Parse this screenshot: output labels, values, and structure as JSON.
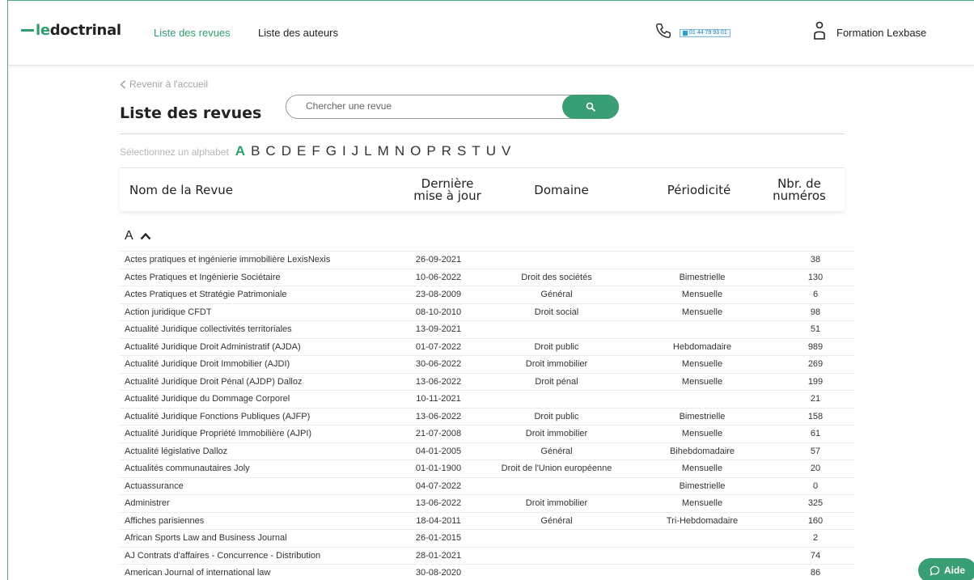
{
  "header": {
    "logo_prefix": "le",
    "logo_suffix": "doctrinal",
    "nav": [
      {
        "label": "Liste des revues",
        "active": true
      },
      {
        "label": "Liste des auteurs",
        "active": false
      }
    ],
    "phone_number": "01 44 79 93 01",
    "user_name": "Formation Lexbase"
  },
  "back_link": "Revenir à l'accueil",
  "page_title": "Liste des revues",
  "search": {
    "placeholder": "Chercher une revue",
    "value": ""
  },
  "alphabet": {
    "label": "Sélectionnez un alphabet",
    "letters": [
      "A",
      "B",
      "C",
      "D",
      "E",
      "F",
      "G",
      "I",
      "J",
      "L",
      "M",
      "N",
      "O",
      "P",
      "R",
      "S",
      "T",
      "U",
      "V"
    ],
    "active": "A"
  },
  "table": {
    "headers": {
      "name": "Nom de la Revue",
      "date_line1": "Dernière",
      "date_line2": "mise à jour",
      "domain": "Domaine",
      "periodicity": "Périodicité",
      "count_line1": "Nbr. de",
      "count_line2": "numéros"
    },
    "section": "A",
    "rows": [
      {
        "name": "Actes pratiques et ingénierie immobilière LexisNexis",
        "date": "26-09-2021",
        "domain": "",
        "periodicity": "",
        "count": "38"
      },
      {
        "name": "Actes Pratiques et Ingénierie Sociétaire",
        "date": "10-06-2022",
        "domain": "Droit des sociétés",
        "periodicity": "Bimestrielle",
        "count": "130"
      },
      {
        "name": "Actes Pratiques et Stratégie Patrimoniale",
        "date": "23-08-2009",
        "domain": "Général",
        "periodicity": "Mensuelle",
        "count": "6"
      },
      {
        "name": "Action juridique CFDT",
        "date": "08-10-2010",
        "domain": "Droit social",
        "periodicity": "Mensuelle",
        "count": "98"
      },
      {
        "name": "Actualité Juridique collectivités territoriales",
        "date": "13-09-2021",
        "domain": "",
        "periodicity": "",
        "count": "51"
      },
      {
        "name": "Actualité Juridique Droit Administratif (AJDA)",
        "date": "01-07-2022",
        "domain": "Droit public",
        "periodicity": "Hebdomadaire",
        "count": "989"
      },
      {
        "name": "Actualité Juridique Droit Immobilier (AJDI)",
        "date": "30-06-2022",
        "domain": "Droit immobilier",
        "periodicity": "Mensuelle",
        "count": "269"
      },
      {
        "name": "Actualité Juridique Droit Pénal (AJDP) Dalloz",
        "date": "13-06-2022",
        "domain": "Droit pénal",
        "periodicity": "Mensuelle",
        "count": "199"
      },
      {
        "name": "Actualité Juridique du Dommage Corporel",
        "date": "10-11-2021",
        "domain": "",
        "periodicity": "",
        "count": "21"
      },
      {
        "name": "Actualité Juridique Fonctions Publiques (AJFP)",
        "date": "13-06-2022",
        "domain": "Droit public",
        "periodicity": "Bimestrielle",
        "count": "158"
      },
      {
        "name": "Actualité Juridique Propriété Immobilière (AJPI)",
        "date": "21-07-2008",
        "domain": "Droit immobilier",
        "periodicity": "Mensuelle",
        "count": "61"
      },
      {
        "name": "Actualité législative Dalloz",
        "date": "04-01-2005",
        "domain": "Général",
        "periodicity": "Bihebdomadaire",
        "count": "57"
      },
      {
        "name": "Actualités communautaires Joly",
        "date": "01-01-1900",
        "domain": "Droit de l'Union européenne",
        "periodicity": "Mensuelle",
        "count": "20"
      },
      {
        "name": "Actuassurance",
        "date": "04-07-2022",
        "domain": "",
        "periodicity": "Bimestrielle",
        "count": "0"
      },
      {
        "name": "Administrer",
        "date": "13-06-2022",
        "domain": "Droit immobilier",
        "periodicity": "Mensuelle",
        "count": "325"
      },
      {
        "name": "Affiches parisiennes",
        "date": "18-04-2011",
        "domain": "Général",
        "periodicity": "Tri-Hebdomadaire",
        "count": "160"
      },
      {
        "name": "African Sports Law and Business Journal",
        "date": "26-01-2015",
        "domain": "",
        "periodicity": "",
        "count": "2"
      },
      {
        "name": "AJ Contrats d'affaires - Concurrence - Distribution",
        "date": "28-01-2021",
        "domain": "",
        "periodicity": "",
        "count": "74"
      },
      {
        "name": "American Journal of international law",
        "date": "30-08-2020",
        "domain": "",
        "periodicity": "",
        "count": "86"
      }
    ]
  },
  "help_button": "Aide",
  "colors": {
    "accent": "#2f9e6f",
    "button": "#3a9e74"
  }
}
